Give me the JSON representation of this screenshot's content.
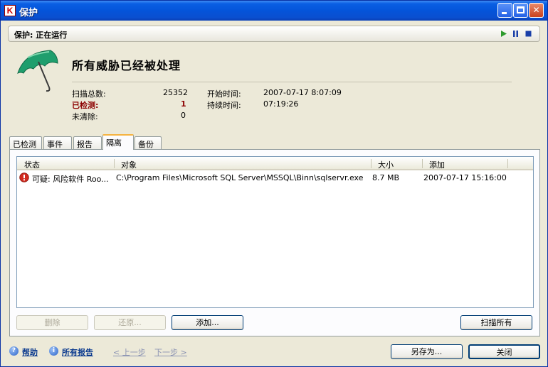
{
  "window": {
    "title": "保护"
  },
  "status": {
    "text": "保护: 正在运行"
  },
  "summary": {
    "headline": "所有威胁已经被处理",
    "stats": [
      {
        "label": "扫描总数:",
        "value": "25352"
      },
      {
        "label": "已检测:",
        "value": "1"
      },
      {
        "label": "未清除:",
        "value": "0"
      }
    ],
    "time": [
      {
        "label": "开始时间:",
        "value": "2007-07-17 8:07:09"
      },
      {
        "label": "持续时间:",
        "value": "07:19:26"
      }
    ]
  },
  "tabs": [
    "已检测",
    "事件",
    "报告",
    "隔离",
    "备份"
  ],
  "active_tab": "隔离",
  "table": {
    "columns": [
      "状态",
      "对象",
      "大小",
      "添加"
    ],
    "rows": [
      {
        "status": "可疑: 风险软件 Roo...",
        "object": "C:\\Program Files\\Microsoft SQL Server\\MSSQL\\Binn\\sqlservr.exe",
        "size": "8.7 MB",
        "added": "2007-07-17 15:16:00"
      }
    ]
  },
  "buttons": {
    "delete": "删除",
    "restore": "还原...",
    "add": "添加...",
    "scan_all": "扫描所有",
    "save_as": "另存为...",
    "close": "关闭"
  },
  "footer": {
    "help": "帮助",
    "all_reports": "所有报告",
    "prev": "< 上一步",
    "next": "下一步 >"
  },
  "colors": {
    "titlebar": "#0454da",
    "detected_red": "#8c0000",
    "link_blue": "#0b3a8e",
    "umbrella_green": "#1f9e6d"
  }
}
